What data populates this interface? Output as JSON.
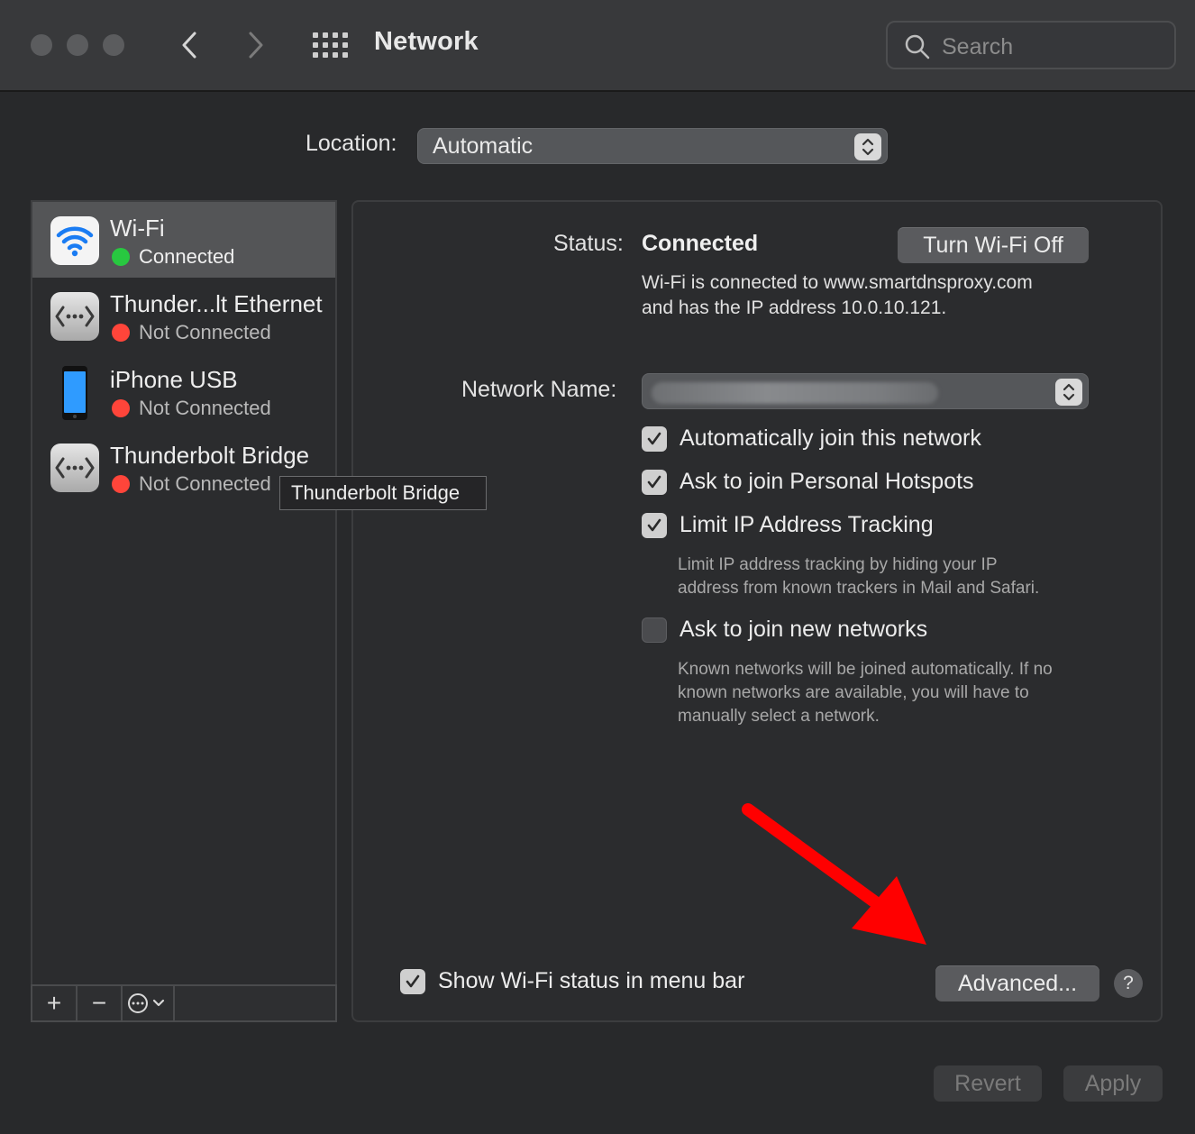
{
  "window": {
    "title": "Network"
  },
  "toolbar": {
    "search_placeholder": "Search"
  },
  "location": {
    "label": "Location:",
    "value": "Automatic"
  },
  "services": [
    {
      "name": "Wi-Fi",
      "status": "Connected",
      "status_color": "#28c840",
      "icon": "wifi-icon"
    },
    {
      "name": "Thunder...lt Ethernet",
      "status": "Not Connected",
      "status_color": "#ff453a",
      "icon": "ethernet-icon"
    },
    {
      "name": "iPhone USB",
      "status": "Not Connected",
      "status_color": "#ff453a",
      "icon": "iphone-icon"
    },
    {
      "name": "Thunderbolt Bridge",
      "status": "Not Connected",
      "status_color": "#ff453a",
      "icon": "bridge-icon"
    }
  ],
  "tooltip": "Thunderbolt Bridge",
  "sidebar_toolbar": {
    "add": "+",
    "remove": "−"
  },
  "detail": {
    "status_label": "Status:",
    "status_value": "Connected",
    "turn_off_button": "Turn Wi-Fi Off",
    "status_desc_line1": "Wi-Fi is connected to www.smartdnsproxy.com",
    "status_desc_line2": "and has the IP address 10.0.10.121.",
    "network_name_label": "Network Name:",
    "options": [
      {
        "label": "Automatically join this network",
        "checked": true
      },
      {
        "label": "Ask to join Personal Hotspots",
        "checked": true
      },
      {
        "label": "Limit IP Address Tracking",
        "checked": true
      },
      {
        "label": "Ask to join new networks",
        "checked": false
      }
    ],
    "limit_note_line1": "Limit IP address tracking by hiding your IP",
    "limit_note_line2": "address from known trackers in Mail and Safari.",
    "ask_note_line1": "Known networks will be joined automatically. If no",
    "ask_note_line2": "known networks are available, you will have to",
    "ask_note_line3": "manually select a network.",
    "show_status_label": "Show Wi-Fi status in menu bar",
    "show_status_checked": true,
    "advanced_button": "Advanced...",
    "help_button": "?"
  },
  "footer": {
    "revert": "Revert",
    "apply": "Apply"
  },
  "colors": {
    "accent_arrow": "#ff0000",
    "connected": "#28c840",
    "disconnected": "#ff453a"
  }
}
